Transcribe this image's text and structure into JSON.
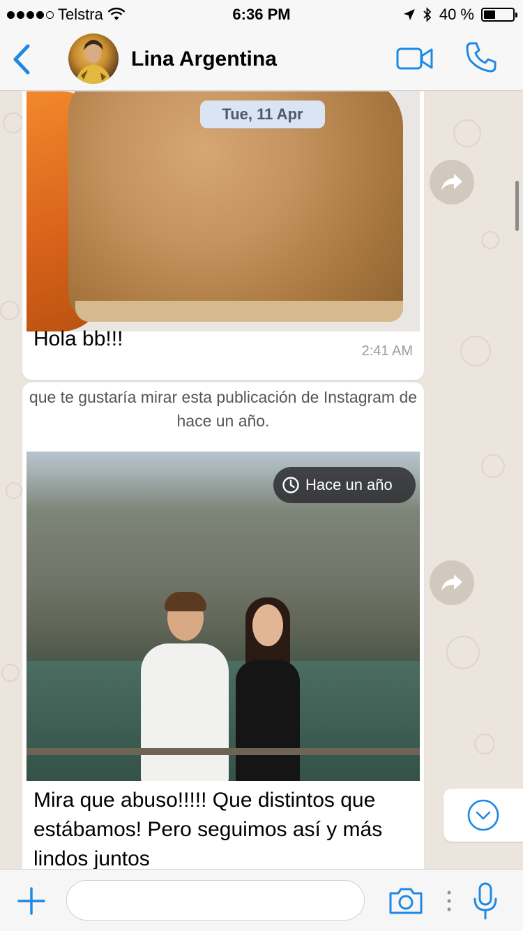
{
  "status_bar": {
    "carrier": "Telstra",
    "time": "6:36 PM",
    "battery": "40 %",
    "battery_level": 0.4
  },
  "header": {
    "contact_name": "Lina Argentina"
  },
  "chat": {
    "date_separator": "Tue, 11 Apr",
    "messages": [
      {
        "text": "Hola bb!!!",
        "time": "2:41 AM"
      },
      {
        "preview_text": "que te gustaría mirar esta publicación de Instagram de hace un año.",
        "photo_badge": "Hace un año",
        "text": "Mira que abuso!!!!! Que distintos que estábamos! Pero seguimos así y más lindos juntos"
      }
    ]
  },
  "input": {
    "placeholder": ""
  },
  "colors": {
    "accent": "#1e88e5",
    "chat_bg": "#ece5dd",
    "bubble": "#ffffff",
    "date_pill": "#dbe4f2"
  }
}
